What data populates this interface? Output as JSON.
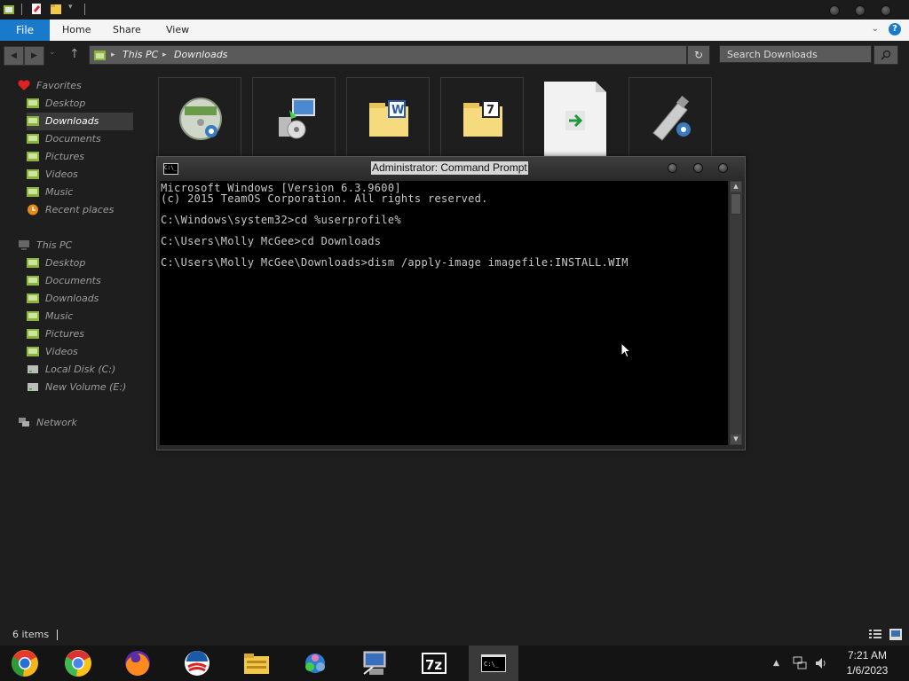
{
  "ribbon": {
    "file_tab": "File",
    "tabs": [
      "Home",
      "Share",
      "View"
    ]
  },
  "address": {
    "crumbs": [
      "This PC",
      "Downloads"
    ],
    "search_placeholder": "Search Downloads"
  },
  "nav": {
    "favorites_header": "Favorites",
    "favorites": [
      "Desktop",
      "Downloads",
      "Documents",
      "Pictures",
      "Videos",
      "Music",
      "Recent places"
    ],
    "thispc_header": "This PC",
    "thispc": [
      "Desktop",
      "Documents",
      "Downloads",
      "Music",
      "Pictures",
      "Videos",
      "Local Disk (C:)",
      "New Volume (E:)"
    ],
    "network": "Network",
    "selected": "Downloads"
  },
  "cmd": {
    "title": "Administrator: Command Prompt",
    "icon_text": "C:\\_",
    "lines": [
      "Microsoft Windows [Version 6.3.9600]",
      "(c) 2015 TeamOS Corporation. All rights reserved.",
      "",
      "C:\\Windows\\system32>cd %userprofile%",
      "",
      "C:\\Users\\Molly McGee>cd Downloads",
      "",
      "C:\\Users\\Molly McGee\\Downloads>dism /apply-image imagefile:INSTALL.WIM"
    ]
  },
  "status": {
    "items_count": "6 items"
  },
  "taskbar": {
    "apps": [
      "chrome-canary-icon",
      "chrome-icon",
      "firefox-icon",
      "campaign-logo-icon",
      "file-explorer-icon",
      "network-people-icon",
      "remote-desktop-icon",
      "7zip-icon",
      "command-prompt-icon"
    ],
    "active": "command-prompt-icon"
  },
  "clock": {
    "time": "7:21 AM",
    "date": "1/6/2023"
  },
  "colors": {
    "accent": "#1979ca",
    "background": "#1e1e1e",
    "console": "#000000"
  }
}
